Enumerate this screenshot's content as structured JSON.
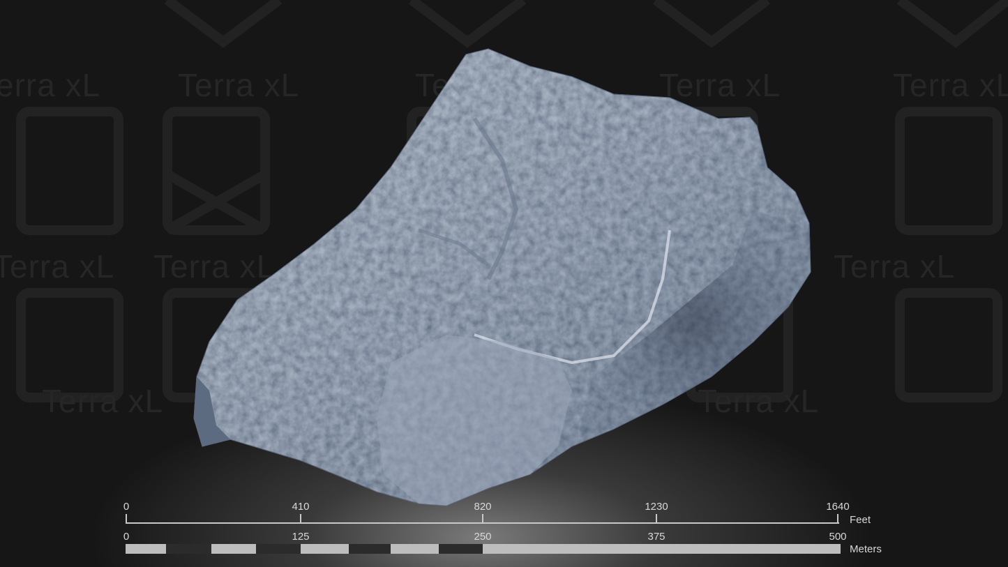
{
  "watermark": {
    "text": "Terra xL"
  },
  "map": {
    "feet_scale": {
      "unit": "Feet",
      "ticks": [
        "0",
        "410",
        "820",
        "1230",
        "1640"
      ]
    },
    "meter_scale": {
      "unit": "Meters",
      "ticks": [
        "0",
        "125",
        "250",
        "375",
        "500"
      ],
      "segment_colors": [
        "#bdbdbd",
        "#2b2b2b",
        "#bdbdbd",
        "#2b2b2b",
        "#bdbdbd",
        "#2b2b2b",
        "#bdbdbd",
        "#2b2b2b",
        "#bdbdbd"
      ]
    },
    "terrain_color": "#aab6c6"
  }
}
